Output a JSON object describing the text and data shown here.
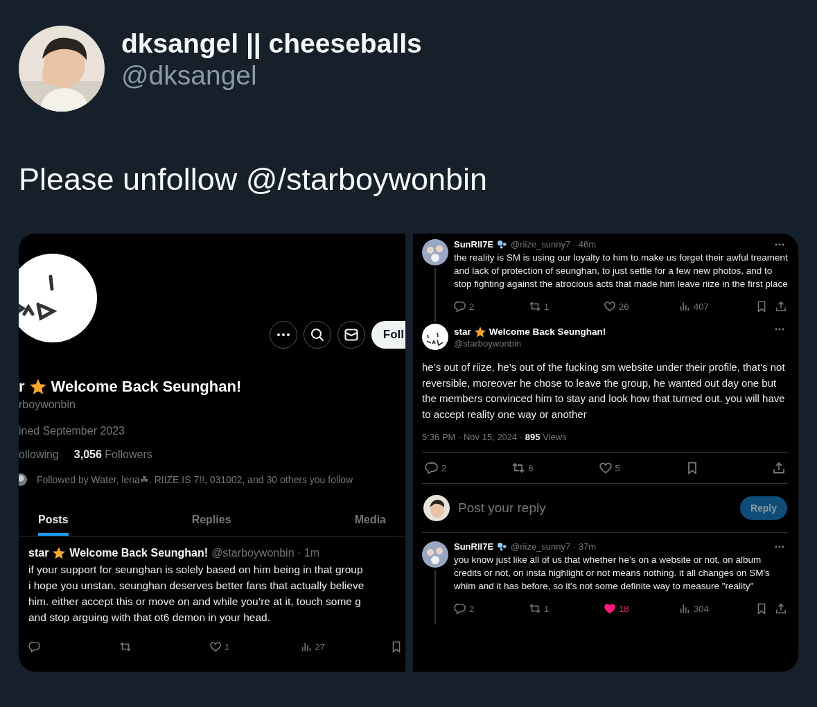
{
  "tweet": {
    "name": "dksangel || cheeseballs",
    "handle": "@dksangel",
    "text": "Please unfollow @/starboywonbin"
  },
  "left_screenshot": {
    "profile": {
      "follow_button": "Foll",
      "name_prefix": "r",
      "name": "Welcome Back Seunghan!",
      "handle": "rboywonbin",
      "joined": "ined September 2023",
      "following": "ollowing",
      "followers": "**3,056** Followers",
      "followed_by": "Followed by Water, lena☘. RIIZE IS 7!!, 031002, and 30 others you follow"
    },
    "tabs": [
      {
        "label": "Posts",
        "selected": true
      },
      {
        "label": "Replies",
        "selected": false
      },
      {
        "label": "Media",
        "selected": false
      }
    ],
    "post": {
      "name_prefix": "star",
      "name": "Welcome Back Seunghan!",
      "meta": "@starboywonbin · 1m",
      "lines": [
        "if your support for seunghan is solely based on him being in that group",
        "i hope you unstan. seunghan deserves better fans that actually believe",
        "him. either accept this or move on and while you’re at it, touch some g",
        "and stop arguing with that ot6 demon in your head."
      ],
      "actions": [
        {
          "kind": "reply"
        },
        {
          "kind": "repost"
        },
        {
          "kind": "like",
          "count": "1",
          "on": false
        },
        {
          "kind": "views",
          "count": "27"
        },
        {
          "kind": "bookmark"
        }
      ]
    }
  },
  "right_screenshot": {
    "reply_1": {
      "name": "SunRII7E",
      "meta": "@riize_sunny7 · 46m",
      "text": "the reality is SM is using our loyalty to him to make us forget their awful treament and lack of protection of seunghan, to just settle for a few new photos, and to stop fighting against the atrocious acts that made him leave riize in the first place",
      "actions": [
        {
          "kind": "reply",
          "count": "2"
        },
        {
          "kind": "repost",
          "count": "1"
        },
        {
          "kind": "like",
          "count": "26",
          "on": false
        },
        {
          "kind": "views",
          "count": "407"
        },
        {
          "kind": "bookmark"
        },
        {
          "kind": "share"
        }
      ]
    },
    "main": {
      "name_prefix": "star",
      "name": "Welcome Back Seunghan!",
      "handle": "@starboywonbin",
      "text": "he’s out of riize, he’s out of the fucking sm website under their profile, that’s not reversible, moreover he chose to leave the group, he wanted out day one but the members convinced him to stay and look how that turned out. you will have to accept reality one way or another",
      "timestamp": "5:36 PM · Nov 15, 2024 · **895** Views",
      "actions": [
        {
          "kind": "reply",
          "count": "2"
        },
        {
          "kind": "repost",
          "count": "6"
        },
        {
          "kind": "like",
          "count": "5",
          "on": false
        },
        {
          "kind": "bookmark"
        },
        {
          "kind": "share"
        }
      ]
    },
    "composer": {
      "placeholder": "Post your reply",
      "button": "Reply",
      "disabled": true
    },
    "reply_2": {
      "name": "SunRII7E",
      "meta": "@riize_sunny7 · 37m",
      "text": "you know just like all of us that whether he’s on a website or not, on album credits or not, on insta highlight or not means nothing. it all changes on SM's whim and it has before, so it's not some definite way to measure \"reality\"",
      "actions": [
        {
          "kind": "reply",
          "count": "2"
        },
        {
          "kind": "repost",
          "count": "1"
        },
        {
          "kind": "like",
          "count": "18",
          "on": true
        },
        {
          "kind": "views",
          "count": "304"
        },
        {
          "kind": "bookmark"
        },
        {
          "kind": "share"
        }
      ]
    }
  }
}
